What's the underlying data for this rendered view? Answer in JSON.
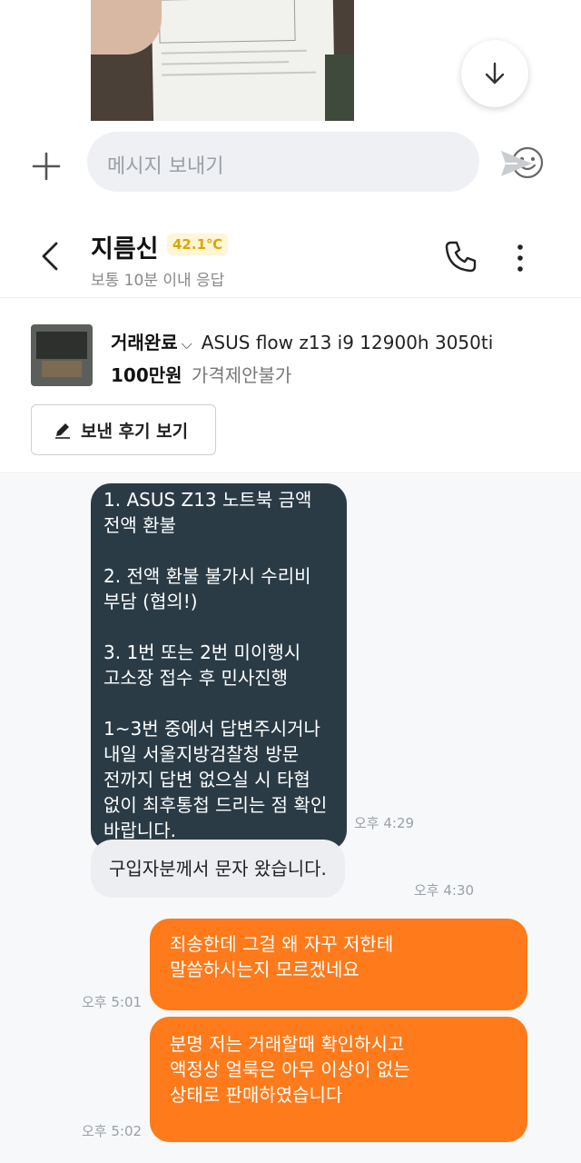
{
  "input": {
    "placeholder": "메시지 보내기"
  },
  "header": {
    "seller_name": "지름신",
    "temperature": "42.1℃",
    "reply_time": "보통 10분 이내 응답"
  },
  "product": {
    "status": "거래완료",
    "title": "ASUS flow z13 i9 12900h 3050ti",
    "price": "100만원",
    "negotiation": "가격제안불가",
    "review_button_label": "보낸 후기 보기"
  },
  "messages": [
    {
      "sender": "other",
      "text": "1. ASUS Z13 노트북 금액\n전액 환불\n\n2. 전액 환불 불가시 수리비\n부담 (협의!)\n\n3. 1번 또는 2번 미이행시\n고소장 접수 후 민사진행\n\n1~3번 중에서 답변주시거나\n내일 서울지방검찰청 방문\n전까지 답변 없으실 시 타협\n없이 최후통첩 드리는 점 확인\n바랍니다.",
      "time": "오후 4:29"
    },
    {
      "sender": "other",
      "text": "구입자분께서 문자 왔습니다.",
      "time": "오후 4:30"
    },
    {
      "sender": "me",
      "text": "죄송한데 그걸 왜 자꾸 저한테\n말씀하시는지 모르겠네요",
      "time": "오후 5:01"
    },
    {
      "sender": "me",
      "text": "분명 저는 거래할때 확인하시고\n액정상 얼룩은 아무 이상이 없는\n상태로 판매하였습니다",
      "time": "오후 5:02"
    }
  ],
  "colors": {
    "my_bubble": "#ff7a1a",
    "their_dark_bubble": "#2a3b46",
    "their_bubble": "#eceef2",
    "temperature": "#e0a400"
  },
  "icons": {
    "scroll_down": "arrow-down-icon",
    "plus": "plus-icon",
    "emoji": "smile-icon",
    "send": "send-icon",
    "back": "chevron-left-icon",
    "call": "phone-icon",
    "more": "more-vertical-icon",
    "review": "pencil-icon"
  }
}
